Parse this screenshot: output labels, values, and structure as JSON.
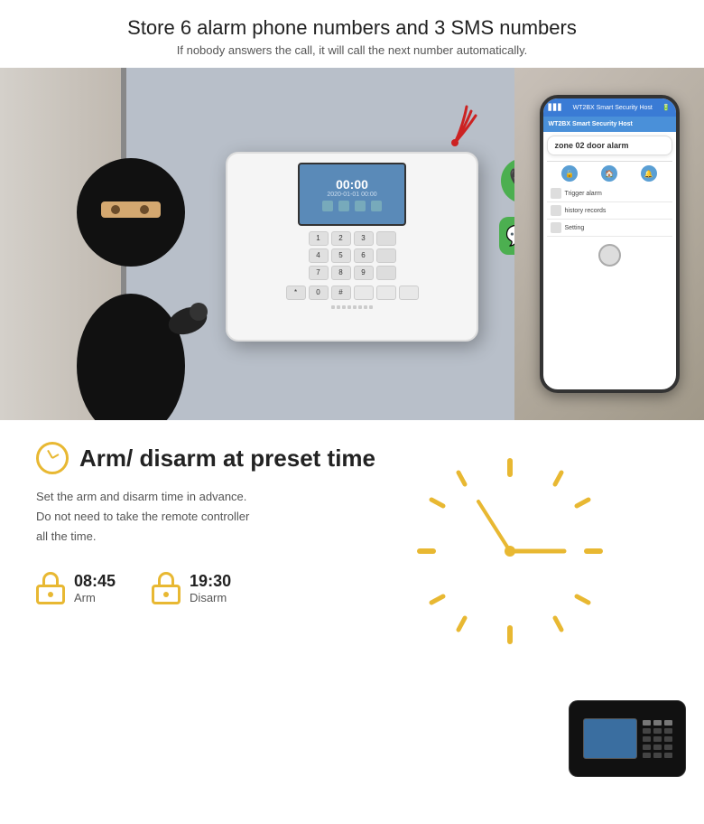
{
  "top": {
    "title": "Store 6 alarm phone numbers and 3 SMS numbers",
    "subtitle": "If nobody answers the call, it will call the next number automatically."
  },
  "phone": {
    "header": "WT2BX Smart Security Host",
    "alarm_text": "zone 02 door alarm",
    "nav_items": [
      "Disarmed",
      "Home",
      "Alarm"
    ],
    "menu_items": [
      "Trigger alarm",
      "History records",
      "Setting"
    ]
  },
  "feature": {
    "title": "Arm/ disarm at preset time",
    "desc_line1": "Set the arm and disarm time in advance.",
    "desc_line2": "Do not need to take the remote controller",
    "desc_line3": "all the time.",
    "time1_value": "08:45",
    "time1_label": "Arm",
    "time2_value": "19:30",
    "time2_label": "Disarm"
  },
  "clock": {
    "ticks": 12,
    "hand_hour_angle": 90,
    "hand_minute_angle": 270
  },
  "colors": {
    "yellow": "#e8b832",
    "green": "#4caf50",
    "blue": "#3a7bd5",
    "dark": "#111111"
  }
}
